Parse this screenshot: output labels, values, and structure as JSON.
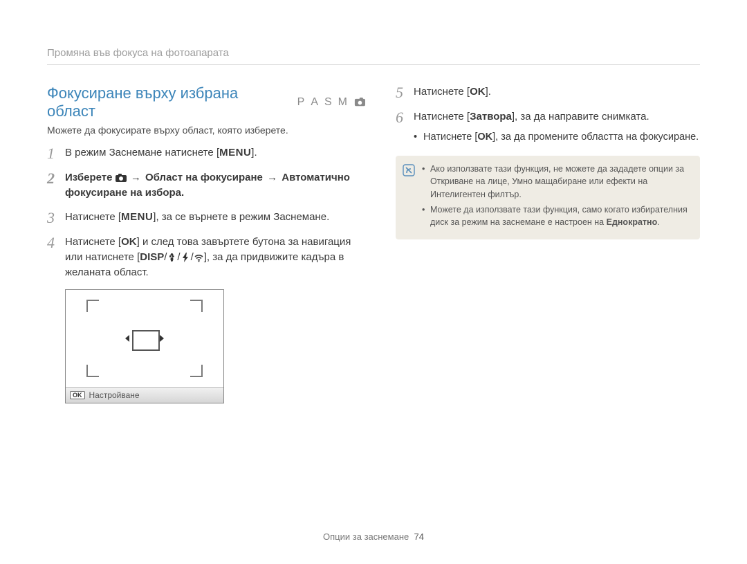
{
  "header": {
    "breadcrumb": "Промяна във фокуса на фотоапарата"
  },
  "section": {
    "title": "Фокусиране върху избрана област",
    "modes": [
      "P",
      "A",
      "S",
      "M"
    ],
    "intro": "Можете да фокусирате върху област, която изберете."
  },
  "steps_left": {
    "s1_pre": "В режим Заснемане натиснете [",
    "s1_menu": "MENU",
    "s1_post": "].",
    "s2_pre": "Изберете ",
    "s2_arrow": "→",
    "s2_b1": "Област на фокусиране",
    "s2_b2": "Автоматично фокусиране на избора",
    "s2_post": ".",
    "s3_pre": "Натиснете [",
    "s3_menu": "MENU",
    "s3_post": "], за се върнете в режим Заснемане.",
    "s4_a": "Натиснете [",
    "s4_ok": "OK",
    "s4_b": "] и след това завъртете бутона за навигация или натиснете [",
    "s4_disp": "DISP",
    "s4_c": "], за да придвижите кадъра в желаната област."
  },
  "diagram": {
    "bar_key": "OK",
    "bar_label": "Настройване"
  },
  "steps_right": {
    "s5_pre": "Натиснете [",
    "s5_ok": "OK",
    "s5_post": "].",
    "s6_pre": "Натиснете [",
    "s6_shutter": "Затвора",
    "s6_post": "], за да направите снимката.",
    "s6_bullet_pre": "Натиснете [",
    "s6_bullet_ok": "OK",
    "s6_bullet_post": "], за да промените областта на фокусиране."
  },
  "info": {
    "n1": "Ако използвате тази функция, не можете да зададете опции за Откриване на лице, Умно мащабиране или ефекти на Интелигентен филтър.",
    "n2_pre": "Можете да използвате тази функция, само когато избирателния диск за режим на заснемане е настроен на ",
    "n2_bold": "Еднократно",
    "n2_post": "."
  },
  "footer": {
    "label": "Опции за заснемане",
    "page": "74"
  }
}
